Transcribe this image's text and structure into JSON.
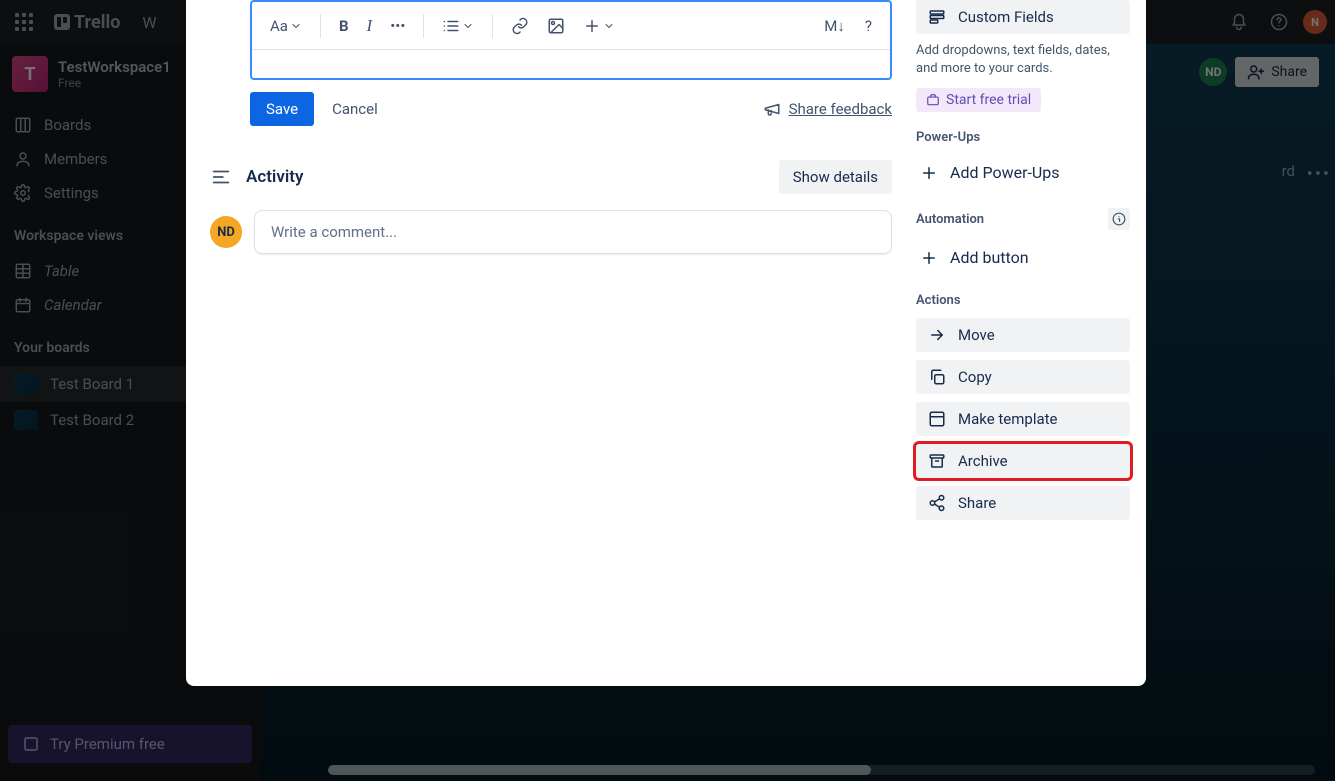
{
  "topnav": {
    "brand": "Trello",
    "workspaces_label": "W"
  },
  "topright": {
    "avatar_initial": "N"
  },
  "workspace": {
    "tile": "T",
    "name": "TestWorkspace1",
    "plan": "Free"
  },
  "sidebar": {
    "items": [
      "Boards",
      "Members",
      "Settings"
    ],
    "views_heading": "Workspace views",
    "views": [
      "Table",
      "Calendar"
    ],
    "your_boards_heading": "Your boards",
    "boards": [
      "Test Board 1",
      "Test Board 2"
    ],
    "premium": "Try Premium free"
  },
  "board": {
    "share": "Share",
    "member_initials": "ND",
    "behind_text": "rd"
  },
  "editor": {
    "text_style": "Aa",
    "markdown": "M↓",
    "help": "?"
  },
  "editor_actions": {
    "save": "Save",
    "cancel": "Cancel",
    "share_feedback": "Share feedback"
  },
  "activity": {
    "heading": "Activity",
    "show_details": "Show details",
    "avatar": "ND",
    "placeholder": "Write a comment..."
  },
  "side": {
    "custom_fields": "Custom Fields",
    "cf_desc": "Add dropdowns, text fields, dates, and more to your cards.",
    "trial": "Start free trial",
    "powerups_heading": "Power-Ups",
    "add_powerups": "Add Power-Ups",
    "automation_heading": "Automation",
    "add_button": "Add button",
    "actions_heading": "Actions",
    "move": "Move",
    "copy": "Copy",
    "template": "Make template",
    "archive": "Archive",
    "share": "Share"
  }
}
